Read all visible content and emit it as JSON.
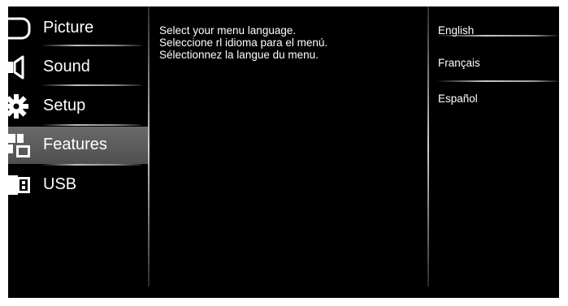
{
  "menu": {
    "items": [
      {
        "label": "Picture",
        "icon": "picture-icon"
      },
      {
        "label": "Sound",
        "icon": "speaker-icon"
      },
      {
        "label": "Setup",
        "icon": "gear-icon"
      },
      {
        "label": "Features",
        "icon": "features-icon"
      },
      {
        "label": "USB",
        "icon": "usb-icon"
      }
    ],
    "selected_index": 3
  },
  "description": {
    "lines": [
      "Select your menu language.",
      "Seleccione rl idioma para el menú.",
      "Sélectionnez la langue du menu."
    ]
  },
  "options": {
    "items": [
      "English",
      "Français",
      "Español"
    ],
    "selected_index": 0
  },
  "colors": {
    "background": "#000000",
    "text": "#ffffff",
    "selected_highlight": "#5e5e5e"
  }
}
